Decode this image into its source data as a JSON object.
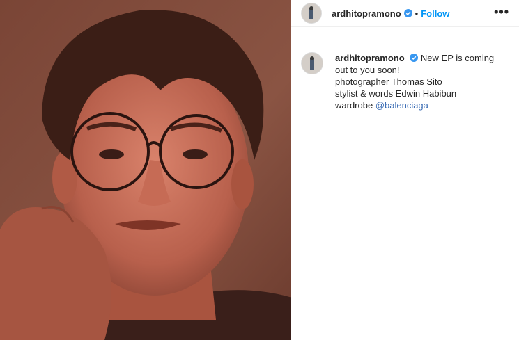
{
  "post": {
    "username": "ardhitopramono",
    "separator": "•",
    "follow_label": "Follow",
    "more_label": "•••",
    "caption": {
      "username": "ardhitopramono",
      "first_text": "New EP is coming",
      "line2": "out to you soon!",
      "line3": "photographer Thomas Sito",
      "line4": "stylist & words Edwin Habibun",
      "line5_prefix": "wardrobe ",
      "mention": "@balenciaga"
    }
  },
  "colors": {
    "follow": "#0095f6",
    "verified": "#3897f0",
    "mention": "#3d6eb5"
  }
}
